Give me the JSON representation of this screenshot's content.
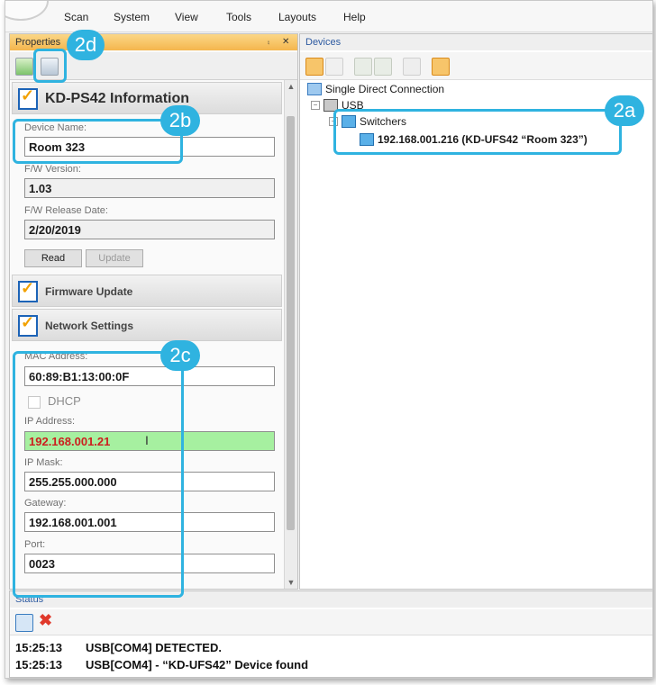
{
  "menubar": {
    "items": [
      "Scan",
      "System",
      "View",
      "Tools",
      "Layouts",
      "Help"
    ]
  },
  "properties_panel": {
    "title": "Properties",
    "pin": "⨾",
    "close": "✕",
    "section": {
      "title": "KD-PS42 Information"
    },
    "device_name": {
      "label": "Device Name:",
      "value": "Room 323"
    },
    "fw_version": {
      "label": "F/W Version:",
      "value": "1.03"
    },
    "fw_release_date": {
      "label": "F/W Release Date:",
      "value": "2/20/2019"
    },
    "read_button": "Read",
    "update_button": "Update",
    "firmware_update": "Firmware Update",
    "network_settings": "Network Settings",
    "mac_address": {
      "label": "MAC Address:",
      "value": "60:89:B1:13:00:0F"
    },
    "dhcp_label": "DHCP",
    "ip_address": {
      "label": "IP Address:",
      "value": "192.168.001.21"
    },
    "ip_mask": {
      "label": "IP Mask:",
      "value": "255.255.000.000"
    },
    "gateway": {
      "label": "Gateway:",
      "value": "192.168.001.001"
    },
    "port": {
      "label": "Port:",
      "value": "0023"
    }
  },
  "devices_panel": {
    "title": "Devices",
    "tree": {
      "root": "Single Direct Connection",
      "usb": "USB",
      "switchers": "Switchers",
      "device": "192.168.001.216  (KD-UFS42 “Room 323”)"
    }
  },
  "status_panel": {
    "title": "Status",
    "log": [
      {
        "time": "15:25:13",
        "message": "USB[COM4] DETECTED."
      },
      {
        "time": "15:25:13",
        "message": "USB[COM4] - “KD-UFS42” Device found"
      }
    ]
  },
  "callouts": {
    "a": "2a",
    "b": "2b",
    "c": "2c",
    "d": "2d"
  },
  "colors": {
    "callout": "#2fb3e0",
    "panel_header_active": "#f4b64d",
    "ip_field_bg": "#a6f0a0",
    "ip_text": "#cc1f1f"
  }
}
